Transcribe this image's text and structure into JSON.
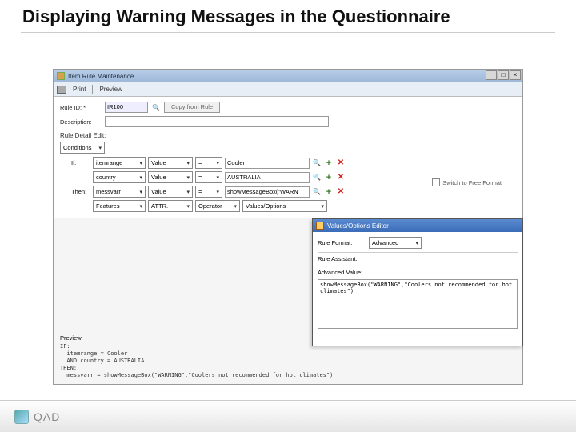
{
  "slide": {
    "title": "Displaying Warning Messages in the Questionnaire"
  },
  "window": {
    "title": "Item Rule Maintenance",
    "toolbar": {
      "print": "Print",
      "preview": "Preview"
    }
  },
  "form": {
    "ruleid_label": "Rule ID: *",
    "ruleid_value": "IR100",
    "copy_btn": "Copy from Rule",
    "desc_label": "Description:",
    "desc_value": "",
    "section": "Rule Detail Edit:",
    "cond_dropdown": "Conditions",
    "rows": [
      {
        "lbl": "If:",
        "a": "itemrange",
        "b": "Value",
        "op": "=",
        "c": "Cooler"
      },
      {
        "lbl": "",
        "a": "country",
        "b": "Value",
        "op": "=",
        "c": "AUSTRALIA"
      },
      {
        "lbl": "Then:",
        "a": "messvarr",
        "b": "Value",
        "op": "=",
        "c": "showMessageBox(\"WARN"
      },
      {
        "lbl": "",
        "a": "Features",
        "b": "ATTR.",
        "op": "Operator",
        "c": "Values/Options"
      }
    ],
    "freefmt": "Switch to Free Format"
  },
  "preview": {
    "head": "Preview:",
    "body": "IF:\n  itemrange = Cooler\n  AND country = AUSTRALIA\nTHEN:\n  messvarr = showMessageBox(\"WARNING\",\"Coolers not recommended for hot climates\")"
  },
  "popup": {
    "title": "Values/Options Editor",
    "fmt_label": "Rule Format:",
    "fmt_value": "Advanced",
    "assist_label": "Rule Assistant:",
    "adv_label": "Advanced Value:",
    "adv_value": "showMessageBox(\"WARNING\",\"Coolers not recommended for hot climates\")"
  },
  "footer": {
    "brand": "QAD"
  }
}
